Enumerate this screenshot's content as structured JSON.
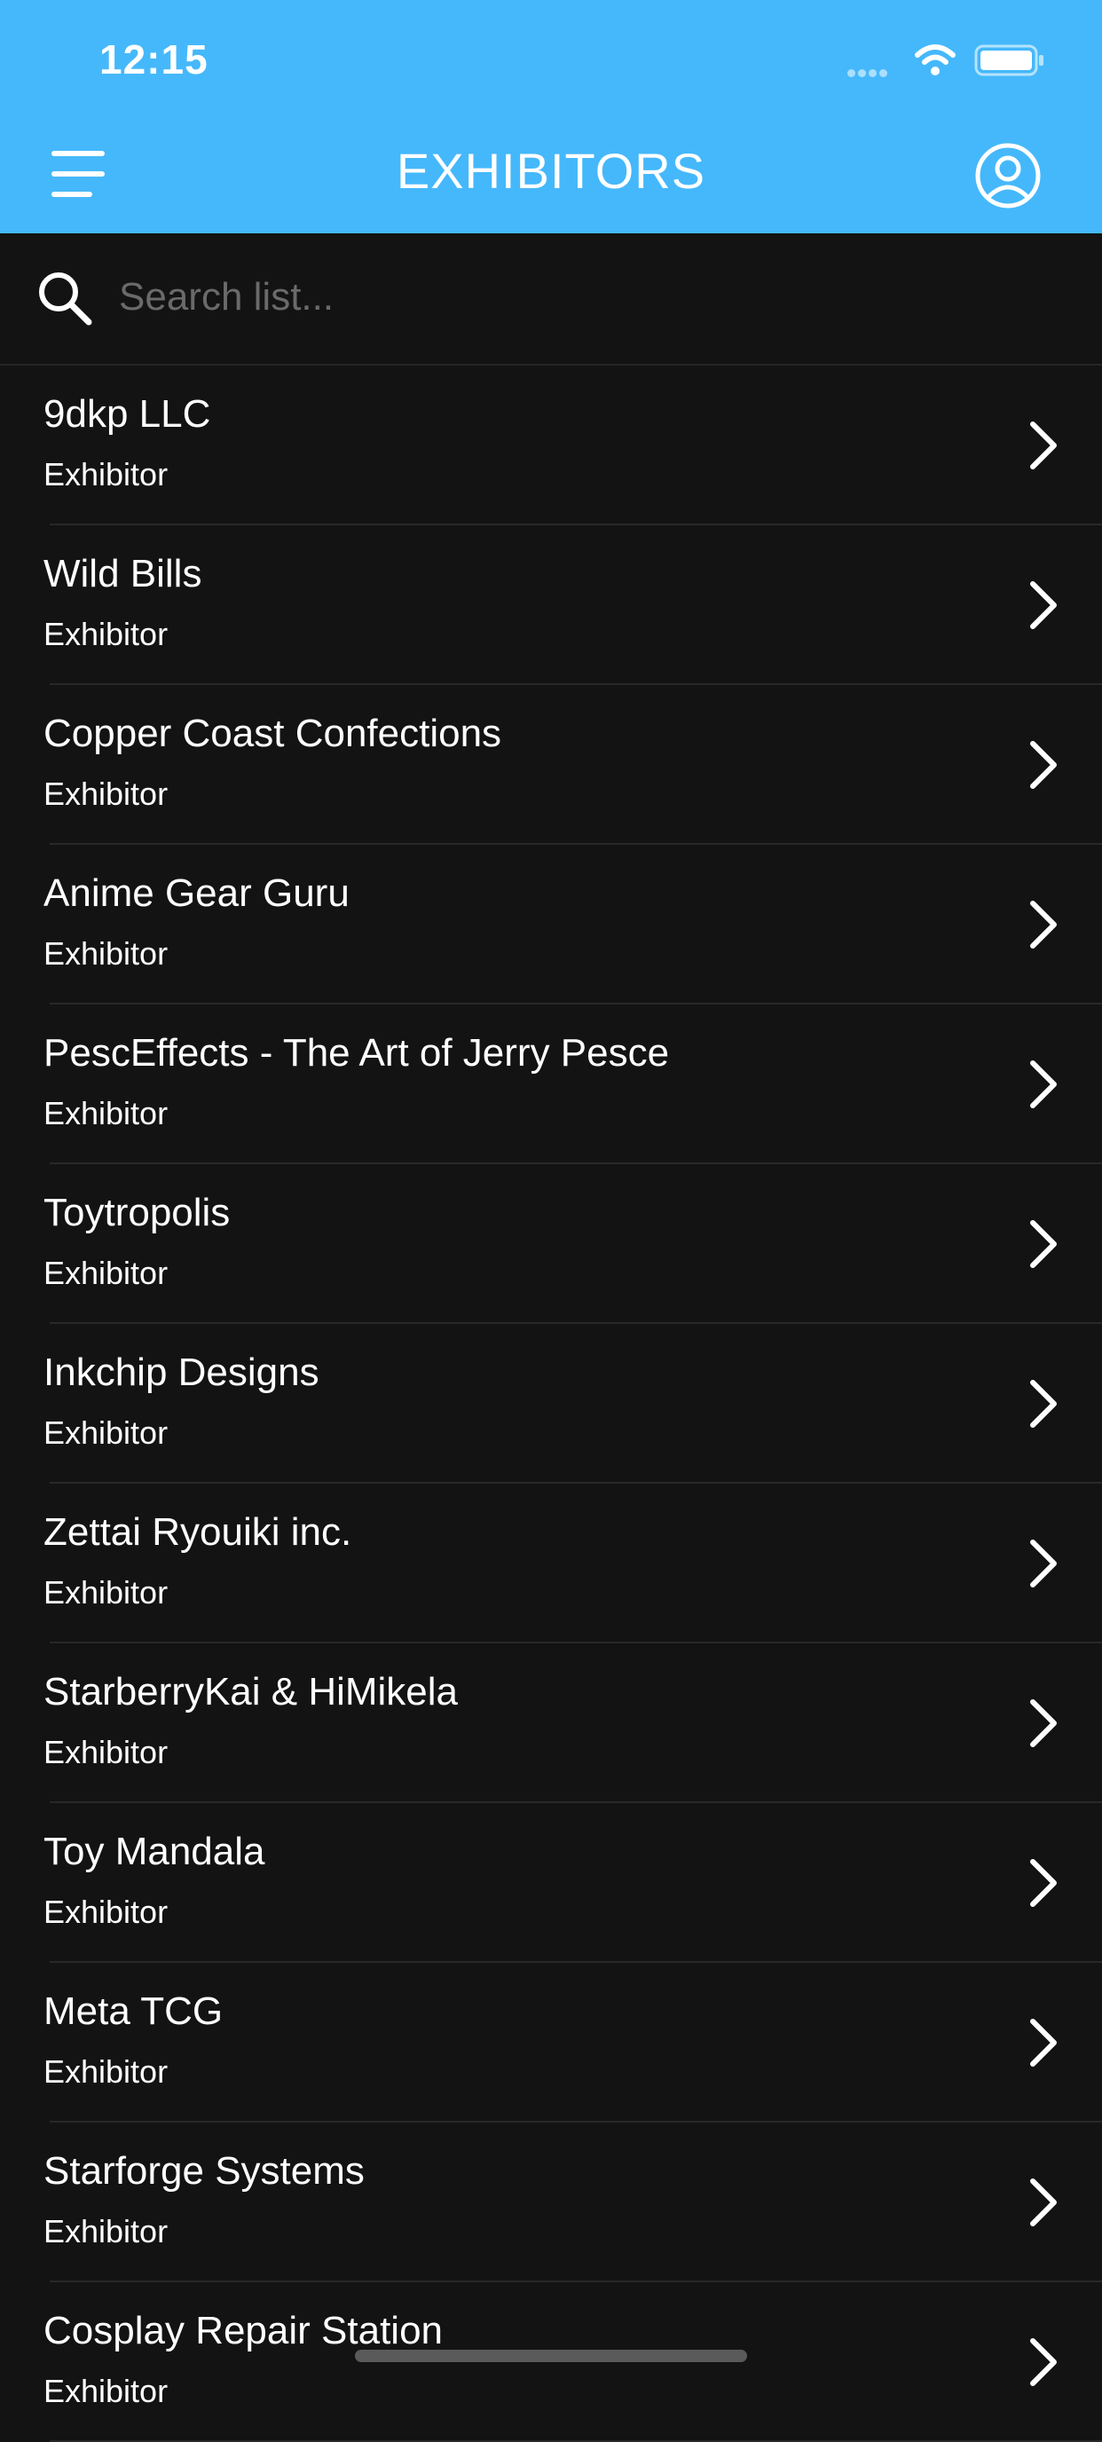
{
  "status_bar": {
    "time": "12:15"
  },
  "header": {
    "title": "EXHIBITORS",
    "background_color": "#45b8fb",
    "menu_icon": "hamburger-icon",
    "profile_icon": "user-circle-icon"
  },
  "search": {
    "placeholder": "Search list...",
    "value": ""
  },
  "exhibitors": [
    {
      "name": "9dkp LLC",
      "type": "Exhibitor"
    },
    {
      "name": "Wild Bills",
      "type": "Exhibitor"
    },
    {
      "name": "Copper Coast Confections",
      "type": "Exhibitor"
    },
    {
      "name": "Anime Gear Guru",
      "type": "Exhibitor"
    },
    {
      "name": "PescEffects - The Art of Jerry Pesce",
      "type": "Exhibitor"
    },
    {
      "name": "Toytropolis",
      "type": "Exhibitor"
    },
    {
      "name": "Inkchip Designs",
      "type": "Exhibitor"
    },
    {
      "name": "Zettai Ryouiki inc.",
      "type": "Exhibitor"
    },
    {
      "name": "StarberryKai & HiMikela",
      "type": "Exhibitor"
    },
    {
      "name": "Toy Mandala",
      "type": "Exhibitor"
    },
    {
      "name": "Meta TCG",
      "type": "Exhibitor"
    },
    {
      "name": "Starforge Systems",
      "type": "Exhibitor"
    },
    {
      "name": "Cosplay Repair Station",
      "type": "Exhibitor"
    }
  ]
}
